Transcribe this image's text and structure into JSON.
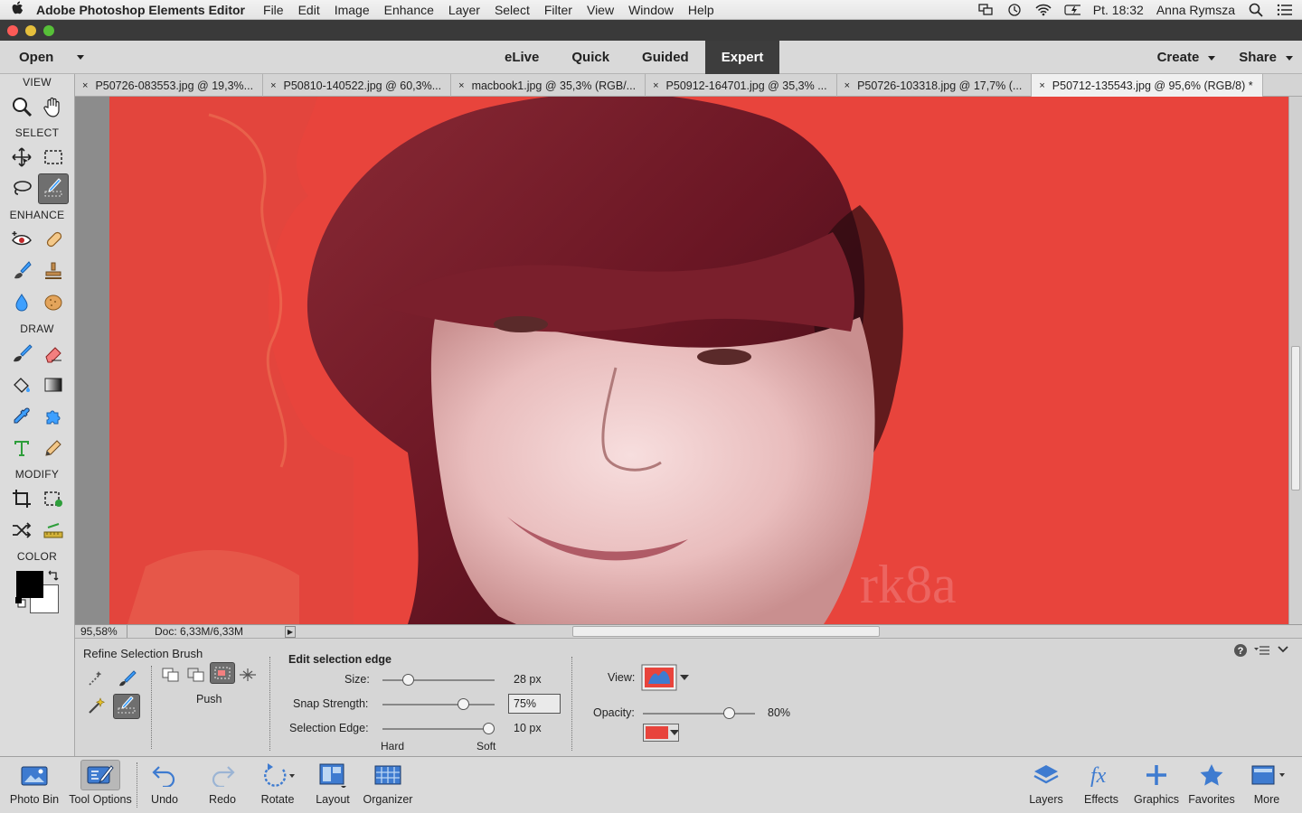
{
  "menubar": {
    "app_name": "Adobe Photoshop Elements Editor",
    "items": [
      "File",
      "Edit",
      "Image",
      "Enhance",
      "Layer",
      "Select",
      "Filter",
      "View",
      "Window",
      "Help"
    ],
    "clock": "Pt. 18:32",
    "user": "Anna Rymsza"
  },
  "header": {
    "open_label": "Open",
    "modes": [
      "eLive",
      "Quick",
      "Guided",
      "Expert"
    ],
    "active_mode": "Expert",
    "create_label": "Create",
    "share_label": "Share"
  },
  "toolbox": {
    "view_label": "VIEW",
    "select_label": "SELECT",
    "enhance_label": "ENHANCE",
    "draw_label": "DRAW",
    "modify_label": "MODIFY",
    "color_label": "COLOR"
  },
  "tabs": [
    {
      "label": "P50726-083553.jpg @ 19,3%..."
    },
    {
      "label": "P50810-140522.jpg @ 60,3%..."
    },
    {
      "label": "macbook1.jpg @ 35,3% (RGB/..."
    },
    {
      "label": "P50912-164701.jpg @ 35,3% ..."
    },
    {
      "label": "P50726-103318.jpg @ 17,7% (..."
    },
    {
      "label": "P50712-135543.jpg @ 95,6% (RGB/8) *"
    }
  ],
  "status": {
    "zoom": "95,58%",
    "doc": "Doc: 6,33M/6,33M"
  },
  "options": {
    "tool_name": "Refine Selection Brush",
    "push_label": "Push",
    "section_title": "Edit selection edge",
    "size_label": "Size:",
    "size_value": "28 px",
    "size_level": 0.2,
    "snap_label": "Snap Strength:",
    "snap_value": "75%",
    "snap_level": 0.75,
    "edge_label": "Selection Edge:",
    "edge_value": "10 px",
    "edge_level": 1.0,
    "hard_label": "Hard",
    "soft_label": "Soft",
    "view_label": "View:",
    "opacity_label": "Opacity:",
    "opacity_value": "80%",
    "opacity_level": 0.8,
    "overlay_color": "#e8443c"
  },
  "taskbar": {
    "photo_bin": "Photo Bin",
    "tool_options": "Tool Options",
    "undo": "Undo",
    "redo": "Redo",
    "rotate": "Rotate",
    "layout": "Layout",
    "organizer": "Organizer",
    "layers": "Layers",
    "effects": "Effects",
    "graphics": "Graphics",
    "favorites": "Favorites",
    "more": "More"
  }
}
